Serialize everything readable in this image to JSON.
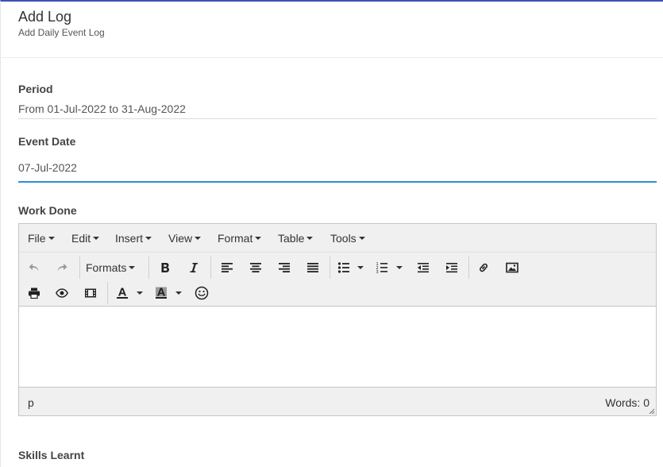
{
  "header": {
    "title": "Add Log",
    "subtitle": "Add Daily Event Log"
  },
  "form": {
    "period": {
      "label": "Period",
      "value": "From 01-Jul-2022 to 31-Aug-2022"
    },
    "event_date": {
      "label": "Event Date",
      "value": "07-Jul-2022"
    },
    "work_done": {
      "label": "Work Done"
    },
    "skills_learnt": {
      "label": "Skills Learnt"
    }
  },
  "editor": {
    "menu": [
      "File",
      "Edit",
      "Insert",
      "View",
      "Format",
      "Table",
      "Tools"
    ],
    "formats_label": "Formats",
    "status_path": "p",
    "word_count": "Words: 0",
    "icons": [
      "undo-icon",
      "redo-icon",
      "bold-icon",
      "italic-icon",
      "align-left-icon",
      "align-center-icon",
      "align-right-icon",
      "align-justify-icon",
      "bullet-list-icon",
      "numbered-list-icon",
      "outdent-icon",
      "indent-icon",
      "link-icon",
      "image-icon",
      "print-icon",
      "preview-icon",
      "media-icon",
      "text-color-icon",
      "background-color-icon",
      "emoticons-icon"
    ]
  },
  "colors": {
    "accent_top": "#3f51b5",
    "focus_underline": "#2d8fd5"
  }
}
